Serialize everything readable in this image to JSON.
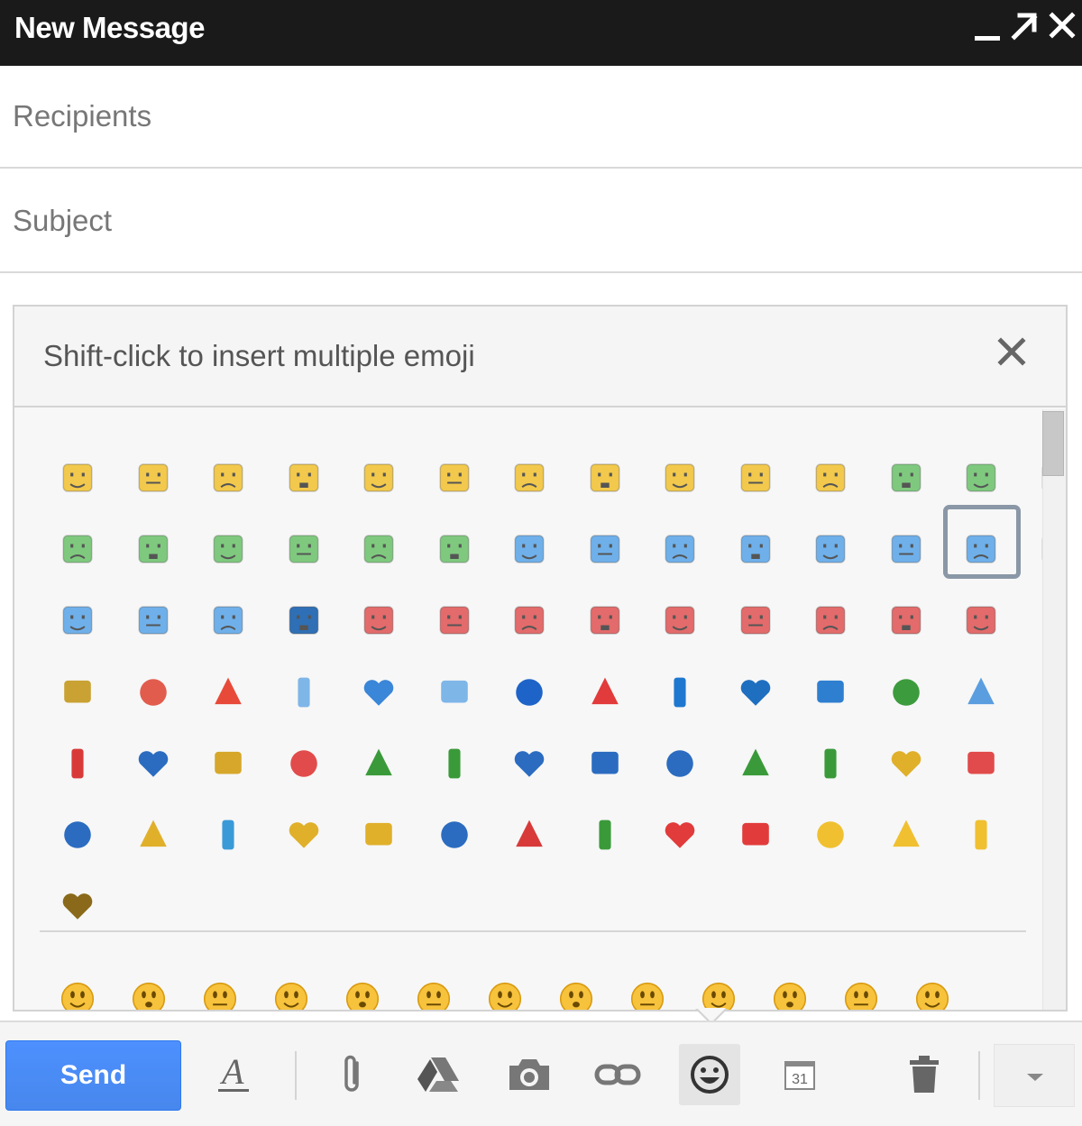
{
  "window": {
    "title": "New Message",
    "controls": [
      "minimize-icon",
      "pop-out-icon",
      "close-icon"
    ]
  },
  "compose": {
    "recipients_placeholder": "Recipients",
    "subject_placeholder": "Subject"
  },
  "emoji_panel": {
    "hint": "Shift-click to insert multiple emoji",
    "close_icon": "close-icon",
    "selected_index": 27,
    "categories": [
      {
        "name": "faces",
        "items": [
          {
            "icon": "happy-face-icon",
            "color": "#f2c94c"
          },
          {
            "icon": "smile-face-icon",
            "color": "#f2c94c"
          },
          {
            "icon": "smirk-face-icon",
            "color": "#f2c94c"
          },
          {
            "icon": "grin-face-icon",
            "color": "#f2c94c"
          },
          {
            "icon": "blush-face-icon",
            "color": "#f2c94c"
          },
          {
            "icon": "wink-face-icon",
            "color": "#f2c94c"
          },
          {
            "icon": "wide-smile-face-icon",
            "color": "#f2c94c"
          },
          {
            "icon": "surprised-face-icon",
            "color": "#f2c94c"
          },
          {
            "icon": "neutral-face-icon",
            "color": "#f2c94c"
          },
          {
            "icon": "ears-face-icon",
            "color": "#f2c94c"
          },
          {
            "icon": "joyful-face-icon",
            "color": "#f2c94c"
          },
          {
            "icon": "green-smile-face-icon",
            "color": "#7fc97f"
          },
          {
            "icon": "green-neutral-face-icon",
            "color": "#7fc97f"
          },
          {
            "icon": "glasses-face-icon",
            "color": "#7fc97f"
          },
          {
            "icon": "green-ears-face-icon",
            "color": "#7fc97f"
          },
          {
            "icon": "green-sad-face-icon",
            "color": "#7fc97f"
          },
          {
            "icon": "green-sick-face-icon",
            "color": "#7fc97f"
          },
          {
            "icon": "green-sweat-face-icon",
            "color": "#7fc97f"
          },
          {
            "icon": "green-unsure-face-icon",
            "color": "#7fc97f"
          },
          {
            "icon": "green-dizzy-face-icon",
            "color": "#7fc97f"
          },
          {
            "icon": "sunglasses-face-icon",
            "color": "#6fb0ea"
          },
          {
            "icon": "blue-sad-face-icon",
            "color": "#6fb0ea"
          },
          {
            "icon": "blue-dead-face-icon",
            "color": "#6fb0ea"
          },
          {
            "icon": "blue-tear-face-icon",
            "color": "#6fb0ea"
          },
          {
            "icon": "blue-scream-face-icon",
            "color": "#6fb0ea"
          },
          {
            "icon": "blue-angry-face-icon",
            "color": "#6fb0ea"
          },
          {
            "icon": "blue-frown-face-icon",
            "color": "#6fb0ea"
          },
          {
            "icon": "blue-worried-face-icon",
            "color": "#6fb0ea"
          },
          {
            "icon": "blue-ears-face-icon",
            "color": "#6fb0ea"
          },
          {
            "icon": "blue-sleepy-face-icon",
            "color": "#6fb0ea"
          },
          {
            "icon": "blue-cry-face-icon",
            "color": "#6fb0ea"
          },
          {
            "icon": "blue-robot-face-icon",
            "color": "#2f6fb5"
          },
          {
            "icon": "red-tongue-face-icon",
            "color": "#e36b6b"
          },
          {
            "icon": "red-laugh-face-icon",
            "color": "#e36b6b"
          },
          {
            "icon": "red-hearts-face-icon",
            "color": "#e36b6b"
          },
          {
            "icon": "red-kiss-face-icon",
            "color": "#e36b6b"
          },
          {
            "icon": "red-mad-face-icon",
            "color": "#e36b6b"
          },
          {
            "icon": "red-pout-face-icon",
            "color": "#e36b6b"
          },
          {
            "icon": "red-x-face-icon",
            "color": "#e36b6b"
          },
          {
            "icon": "devil-face-icon",
            "color": "#e36b6b"
          },
          {
            "icon": "pig-face-icon",
            "color": "#e36b6b"
          }
        ]
      },
      {
        "name": "objects",
        "items": [
          {
            "icon": "monkey-icon",
            "color": "#c9a233"
          },
          {
            "icon": "crab-icon",
            "color": "#e15c4d"
          },
          {
            "icon": "sun-icon",
            "color": "#e84a3a"
          },
          {
            "icon": "cloud-icon",
            "color": "#7fb6e8"
          },
          {
            "icon": "umbrella-icon",
            "color": "#3a86d8"
          },
          {
            "icon": "snowman-icon",
            "color": "#7fb6e8"
          },
          {
            "icon": "moon-icon",
            "color": "#1e64c8"
          },
          {
            "icon": "tulip-icon",
            "color": "#e23b3b"
          },
          {
            "icon": "clover-icon",
            "color": "#1f78d0"
          },
          {
            "icon": "house-icon",
            "color": "#1f6fc0"
          },
          {
            "icon": "camera-icon",
            "color": "#2f7fd0"
          },
          {
            "icon": "gift-icon",
            "color": "#3c9b3c"
          },
          {
            "icon": "mouse-click-icon",
            "color": "#5b9ee0"
          },
          {
            "icon": "phone-icon",
            "color": "#d83a3a"
          },
          {
            "icon": "laptop-icon",
            "color": "#2b6cc0"
          },
          {
            "icon": "briefcase-icon",
            "color": "#d6a72b"
          },
          {
            "icon": "baseball-icon",
            "color": "#e24b4b"
          },
          {
            "icon": "car-icon",
            "color": "#3a9a3a"
          },
          {
            "icon": "microphone-icon",
            "color": "#3a9a3a"
          },
          {
            "icon": "video-camera-icon",
            "color": "#2b6cc0"
          },
          {
            "icon": "music-note-icon",
            "color": "#2b6cc0"
          },
          {
            "icon": "music-notes-icon",
            "color": "#2b6cc0"
          },
          {
            "icon": "tv-icon",
            "color": "#3a9a3a"
          },
          {
            "icon": "boombox-icon",
            "color": "#3a9a3a"
          },
          {
            "icon": "bell-icon",
            "color": "#e0b02b"
          },
          {
            "icon": "cake-icon",
            "color": "#e24b4b"
          },
          {
            "icon": "fork-knife-icon",
            "color": "#2b6cc0"
          },
          {
            "icon": "coffee-cup-icon",
            "color": "#e0b02b"
          },
          {
            "icon": "cocktail-icon",
            "color": "#3a9ad8"
          },
          {
            "icon": "beer-mug-icon",
            "color": "#e0b02b"
          },
          {
            "icon": "exclamation-icon",
            "color": "#e0b02b"
          },
          {
            "icon": "interrobang-icon",
            "color": "#2b6cc0"
          },
          {
            "icon": "double-exclamation-icon",
            "color": "#d83a3a"
          },
          {
            "icon": "question-icon",
            "color": "#3a9a3a"
          },
          {
            "icon": "heart-icon",
            "color": "#e23b3b"
          },
          {
            "icon": "broken-heart-icon",
            "color": "#e23b3b"
          },
          {
            "icon": "light-bulb-icon",
            "color": "#f0c030"
          },
          {
            "icon": "sparkle-icon",
            "color": "#f0c030"
          },
          {
            "icon": "star-icon",
            "color": "#f0c030"
          },
          {
            "icon": "poop-icon",
            "color": "#8a6a1a"
          }
        ]
      },
      {
        "name": "round-faces",
        "items": [
          {
            "icon": "round-smile-icon",
            "color": "#f7c23c"
          },
          {
            "icon": "round-tongue-icon",
            "color": "#f7c23c"
          },
          {
            "icon": "round-kiss-icon",
            "color": "#f7c23c"
          },
          {
            "icon": "round-grin-icon",
            "color": "#f7c23c"
          },
          {
            "icon": "round-oh-icon",
            "color": "#f7c23c"
          },
          {
            "icon": "round-frown-icon",
            "color": "#f7c23c"
          },
          {
            "icon": "round-blush-icon",
            "color": "#f7c23c"
          },
          {
            "icon": "round-laugh-icon",
            "color": "#f7c23c"
          },
          {
            "icon": "round-worry-icon",
            "color": "#f7c23c"
          },
          {
            "icon": "round-teeth-icon",
            "color": "#f7c23c"
          },
          {
            "icon": "round-sly-icon",
            "color": "#f7c23c"
          },
          {
            "icon": "round-cool-icon",
            "color": "#f7c23c"
          },
          {
            "icon": "round-sweat-icon",
            "color": "#f7c23c"
          }
        ]
      }
    ]
  },
  "toolbar": {
    "send_label": "Send",
    "formatting_icon": "formatting-icon",
    "attach_icon": "paperclip-icon",
    "drive_icon": "drive-icon",
    "photo_icon": "camera-icon",
    "link_icon": "link-icon",
    "emoji_icon": "smiley-icon",
    "calendar_icon": "calendar-icon",
    "calendar_day": "31",
    "discard_icon": "trash-icon",
    "more_icon": "dropdown-arrow-icon",
    "formatting_letter": "A"
  }
}
